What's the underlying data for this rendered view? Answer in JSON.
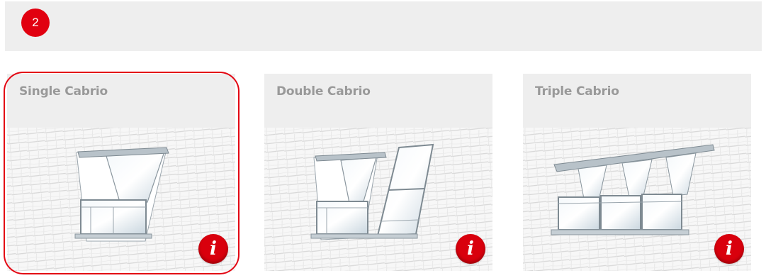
{
  "step": {
    "number": "2"
  },
  "options": [
    {
      "title": "Single Cabrio",
      "info_label": "i",
      "selected": true,
      "image_icon": "single-cabrio-window-illustration"
    },
    {
      "title": "Double Cabrio",
      "info_label": "i",
      "selected": false,
      "image_icon": "double-cabrio-window-illustration"
    },
    {
      "title": "Triple Cabrio",
      "info_label": "i",
      "selected": false,
      "image_icon": "triple-cabrio-window-illustration"
    }
  ],
  "colors": {
    "accent_red": "#e30613",
    "panel_grey": "#eeeeee",
    "title_grey": "#999999"
  }
}
